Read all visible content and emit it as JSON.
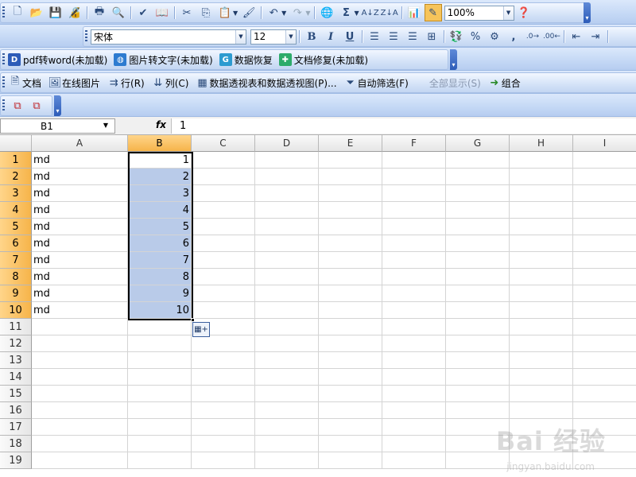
{
  "toolbar_standard": {
    "icons": [
      "new-icon",
      "open-icon",
      "save-icon",
      "permission-icon",
      "print-icon",
      "print-preview-icon",
      "spelling-icon",
      "research-icon",
      "cut-icon",
      "copy-icon",
      "paste-icon",
      "format-painter-icon",
      "undo-icon",
      "redo-icon",
      "hyperlink-icon",
      "autosum-icon",
      "sort-ascending-icon",
      "sort-descending-icon",
      "chart-wizard-icon",
      "drawing-icon",
      "help-icon"
    ],
    "zoom": "100%"
  },
  "toolbar_format": {
    "font_name": "宋体",
    "font_size": "12",
    "bold": "B",
    "italic": "I",
    "underline": "U",
    "percent": "%",
    "comma": ","
  },
  "toolbar_extensions": {
    "items": [
      {
        "icon": "pdf-to-word-icon",
        "label": "pdf转word(未加载)",
        "color": "#2d5cb8"
      },
      {
        "icon": "image-to-text-icon",
        "label": "图片转文字(未加载)",
        "color": "#2d7bd0"
      },
      {
        "icon": "data-recovery-icon",
        "label": "数据恢复",
        "color": "#2d9bd0"
      },
      {
        "icon": "doc-repair-icon",
        "label": "文档修复(未加载)",
        "color": "#2dab6a"
      }
    ]
  },
  "toolbar_pivot": {
    "items": [
      {
        "icon": "doc-icon",
        "label": "文档"
      },
      {
        "icon": "online-image-icon",
        "label": "在线图片"
      },
      {
        "icon": "row-icon",
        "label": "行(R)"
      },
      {
        "icon": "column-icon",
        "label": "列(C)"
      },
      {
        "icon": "pivot-icon",
        "label": "数据透视表和数据透视图(P)..."
      },
      {
        "icon": "autofilter-icon",
        "label": "自动筛选(F)"
      },
      {
        "icon": "show-all-icon",
        "label": "全部显示(S)"
      },
      {
        "icon": "group-icon",
        "label": "组合"
      }
    ]
  },
  "formula_bar": {
    "name_box": "B1",
    "fx": "fx",
    "formula": "1"
  },
  "sheet": {
    "columns": [
      "A",
      "B",
      "C",
      "D",
      "E",
      "F",
      "G",
      "H",
      "I"
    ],
    "selected_column": "B",
    "rows": [
      "1",
      "2",
      "3",
      "4",
      "5",
      "6",
      "7",
      "8",
      "9",
      "10",
      "11",
      "12",
      "13",
      "14",
      "15",
      "16",
      "17",
      "18",
      "19"
    ],
    "col_a": [
      "md",
      "md",
      "md",
      "md",
      "md",
      "md",
      "md",
      "md",
      "md",
      "md"
    ],
    "col_b": [
      "1",
      "2",
      "3",
      "4",
      "5",
      "6",
      "7",
      "8",
      "9",
      "10"
    ]
  },
  "watermark": {
    "text": "Bai 经验",
    "sub": "jingyan.baidu.com"
  }
}
